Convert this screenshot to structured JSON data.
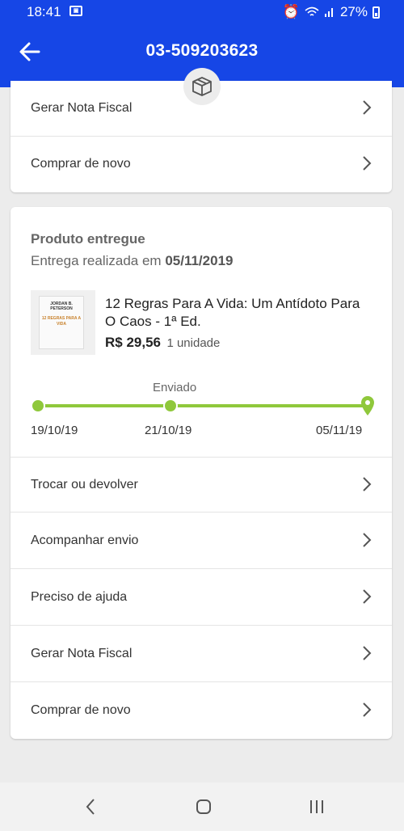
{
  "status": {
    "time": "18:41",
    "battery": "27%"
  },
  "header": {
    "title": "03-509203623"
  },
  "card_top": {
    "rows": [
      {
        "label": "Gerar Nota Fiscal"
      },
      {
        "label": "Comprar de novo"
      }
    ]
  },
  "delivery": {
    "status_title": "Produto entregue",
    "delivered_prefix": "Entrega realizada em",
    "delivered_date": "05/11/2019",
    "thumbnail": {
      "author": "JORDAN B. PETERSON",
      "title": "12 REGRAS PARA A VIDA"
    },
    "product": {
      "name": "12 Regras Para A Vida: Um Antídoto Para O Caos - 1ª Ed.",
      "price": "R$ 29,56",
      "quantity": "1 unidade"
    },
    "timeline": {
      "mid_label": "Enviado",
      "dates": [
        "19/10/19",
        "21/10/19",
        "05/11/19"
      ],
      "progress": 1.0,
      "color": "#8fc83b"
    },
    "actions": [
      {
        "label": "Trocar ou devolver"
      },
      {
        "label": "Acompanhar envio"
      },
      {
        "label": "Preciso de ajuda"
      },
      {
        "label": "Gerar Nota Fiscal"
      },
      {
        "label": "Comprar de novo"
      }
    ]
  },
  "colors": {
    "primary": "#1646e6",
    "accent": "#8fc83b"
  },
  "icons": [
    "back-arrow-icon",
    "box-icon",
    "chevron-right-icon",
    "location-pin-icon",
    "nav-back-icon",
    "nav-home-icon",
    "nav-recents-icon"
  ]
}
